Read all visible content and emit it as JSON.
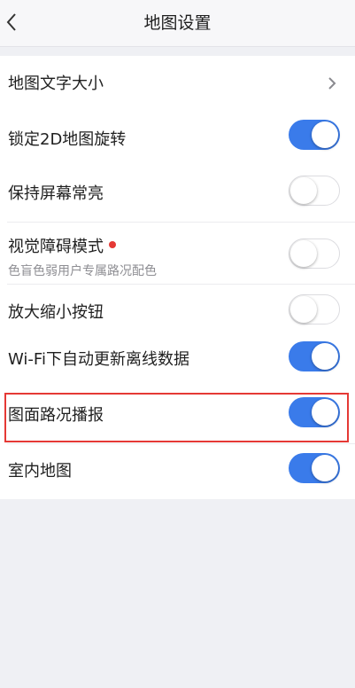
{
  "header": {
    "title": "地图设置"
  },
  "rows": {
    "text_size": {
      "label": "地图文字大小"
    },
    "lock_rotation": {
      "label": "锁定2D地图旋转",
      "on": true
    },
    "keep_screen_on": {
      "label": "保持屏幕常亮",
      "on": false
    },
    "visual_impairment": {
      "label": "视觉障碍模式",
      "sub": "色盲色弱用户专属路况配色",
      "on": false
    },
    "zoom_buttons": {
      "label": "放大缩小按钮",
      "on": false
    },
    "wifi_offline_update": {
      "label": "Wi-Fi下自动更新离线数据",
      "on": true
    },
    "traffic_broadcast": {
      "label": "图面路况播报",
      "on": true
    },
    "indoor_map": {
      "label": "室内地图",
      "on": true
    }
  },
  "colors": {
    "toggle_on": "#3a7bea",
    "badge_dot": "#e53935",
    "highlight_box": "#e53935"
  },
  "icons": {
    "back": "chevron-left-icon",
    "disclosure": "chevron-right-icon"
  }
}
